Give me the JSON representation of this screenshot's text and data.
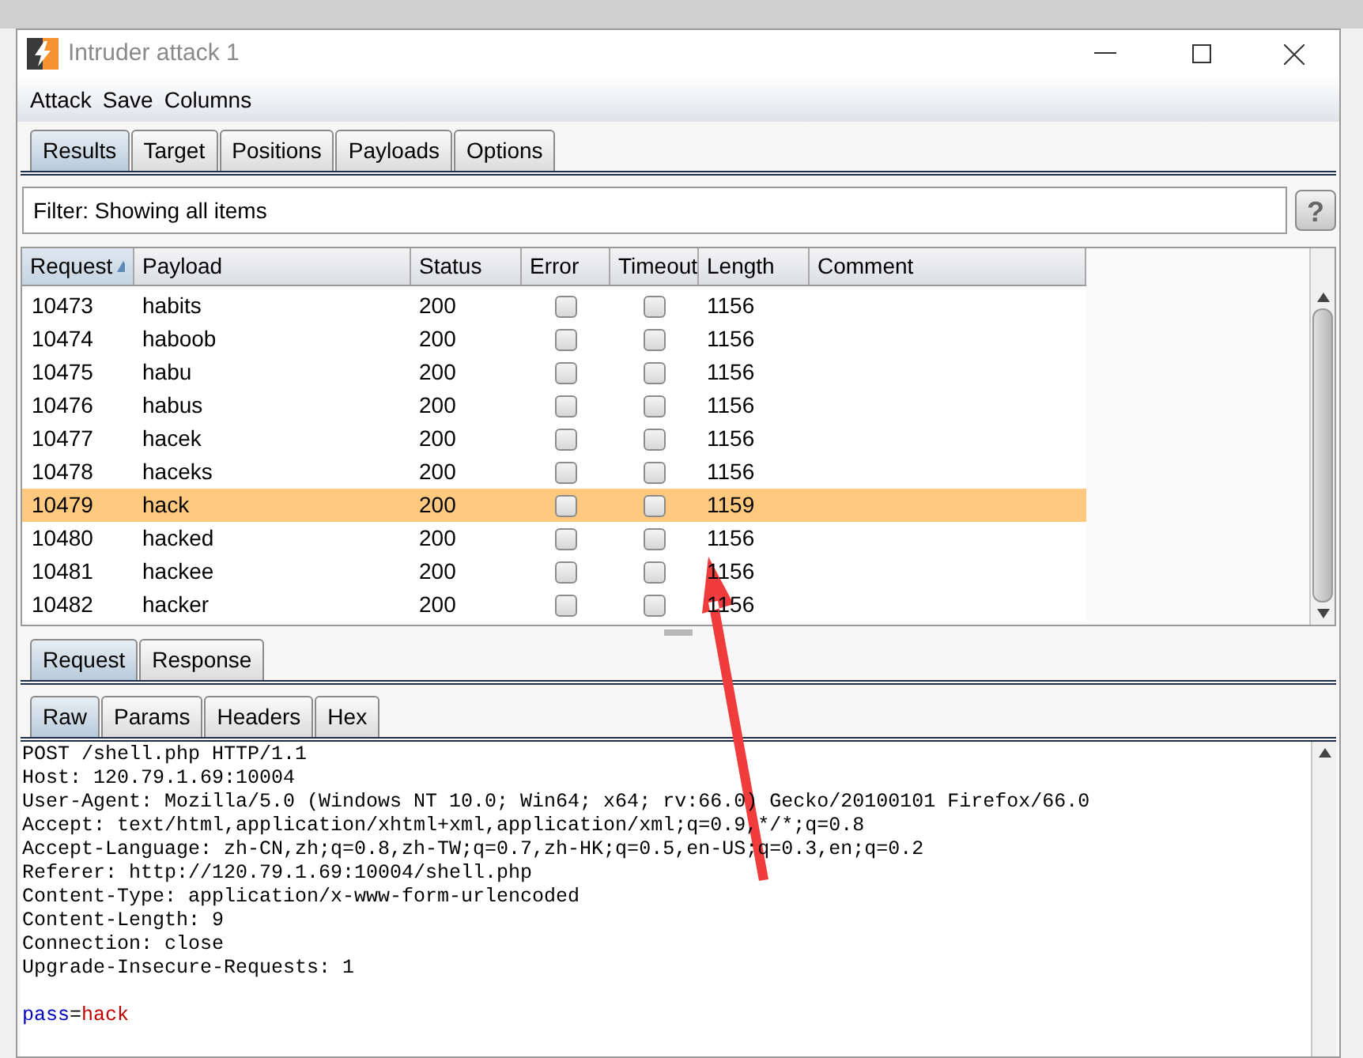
{
  "window": {
    "title": "Intruder attack 1"
  },
  "menu": [
    "Attack",
    "Save",
    "Columns"
  ],
  "tabs": [
    {
      "label": "Results",
      "selected": true
    },
    {
      "label": "Target",
      "selected": false
    },
    {
      "label": "Positions",
      "selected": false
    },
    {
      "label": "Payloads",
      "selected": false
    },
    {
      "label": "Options",
      "selected": false
    }
  ],
  "filter": {
    "text": "Filter: Showing all items",
    "help": "?"
  },
  "table": {
    "columns": [
      {
        "label": "Request",
        "sorted": true
      },
      {
        "label": "Payload",
        "sorted": false
      },
      {
        "label": "Status",
        "sorted": false
      },
      {
        "label": "Error",
        "sorted": false
      },
      {
        "label": "Timeout",
        "sorted": false
      },
      {
        "label": "Length",
        "sorted": false
      },
      {
        "label": "Comment",
        "sorted": false
      }
    ],
    "rows": [
      {
        "request": "10473",
        "payload": "habits",
        "status": "200",
        "error": false,
        "timeout": false,
        "length": "1156",
        "selected": false
      },
      {
        "request": "10474",
        "payload": "haboob",
        "status": "200",
        "error": false,
        "timeout": false,
        "length": "1156",
        "selected": false
      },
      {
        "request": "10475",
        "payload": "habu",
        "status": "200",
        "error": false,
        "timeout": false,
        "length": "1156",
        "selected": false
      },
      {
        "request": "10476",
        "payload": "habus",
        "status": "200",
        "error": false,
        "timeout": false,
        "length": "1156",
        "selected": false
      },
      {
        "request": "10477",
        "payload": "hacek",
        "status": "200",
        "error": false,
        "timeout": false,
        "length": "1156",
        "selected": false
      },
      {
        "request": "10478",
        "payload": "haceks",
        "status": "200",
        "error": false,
        "timeout": false,
        "length": "1156",
        "selected": false
      },
      {
        "request": "10479",
        "payload": "hack",
        "status": "200",
        "error": false,
        "timeout": false,
        "length": "1159",
        "selected": true
      },
      {
        "request": "10480",
        "payload": "hacked",
        "status": "200",
        "error": false,
        "timeout": false,
        "length": "1156",
        "selected": false
      },
      {
        "request": "10481",
        "payload": "hackee",
        "status": "200",
        "error": false,
        "timeout": false,
        "length": "1156",
        "selected": false
      },
      {
        "request": "10482",
        "payload": "hacker",
        "status": "200",
        "error": false,
        "timeout": false,
        "length": "1156",
        "selected": false
      }
    ]
  },
  "message_tabs": [
    {
      "label": "Request",
      "selected": true
    },
    {
      "label": "Response",
      "selected": false
    }
  ],
  "view_tabs": [
    {
      "label": "Raw",
      "selected": true
    },
    {
      "label": "Params",
      "selected": false
    },
    {
      "label": "Headers",
      "selected": false
    },
    {
      "label": "Hex",
      "selected": false
    }
  ],
  "request_lines": [
    "POST /shell.php HTTP/1.1",
    "Host: 120.79.1.69:10004",
    "User-Agent: Mozilla/5.0 (Windows NT 10.0; Win64; x64; rv:66.0) Gecko/20100101 Firefox/66.0",
    "Accept: text/html,application/xhtml+xml,application/xml;q=0.9,*/*;q=0.8",
    "Accept-Language: zh-CN,zh;q=0.8,zh-TW;q=0.7,zh-HK;q=0.5,en-US;q=0.3,en;q=0.2",
    "Referer: http://120.79.1.69:10004/shell.php",
    "Content-Type: application/x-www-form-urlencoded",
    "Content-Length: 9",
    "Connection: close",
    "Upgrade-Insecure-Requests: 1"
  ],
  "request_body": [
    {
      "kind": "name",
      "text": "pass"
    },
    {
      "kind": "plain",
      "text": "="
    },
    {
      "kind": "value",
      "text": "hack"
    }
  ]
}
